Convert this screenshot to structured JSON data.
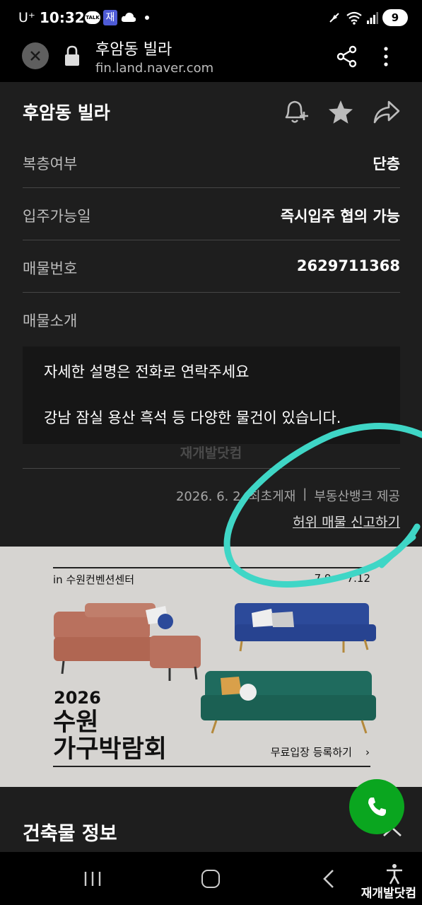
{
  "status_bar": {
    "carrier": "U⁺",
    "time": "10:32",
    "talk_badge": "TALK",
    "app_badge": "재",
    "battery": "9"
  },
  "browser": {
    "title": "후암동 빌라",
    "url": "fin.land.naver.com"
  },
  "listing": {
    "title": "후암동 빌라",
    "rows": [
      {
        "label": "복층여부",
        "value": "단층"
      },
      {
        "label": "입주가능일",
        "value": "즉시입주 협의 가능"
      },
      {
        "label": "매물번호",
        "value": "2629711368"
      }
    ],
    "description_label": "매물소개",
    "description_lines": [
      "자세한 설명은 전화로 연락주세요",
      "강남 잠실 용산 흑석 등 다양한 물건이 있습니다."
    ],
    "watermark": "재개발닷컴",
    "posted_date": "2026. 6. 2. 최초게재",
    "separator": "|",
    "provider": "부동산뱅크 제공",
    "report_link": "허위 매물 신고하기"
  },
  "ad": {
    "venue": "in 수원컨벤션센터",
    "dates": "7.9 ~ 7.12",
    "year": "2026",
    "title_line1": "수원",
    "title_line2": "가구박람회",
    "register": "무료입장 등록하기",
    "register_arrow": "›",
    "colors": {
      "background": "#d6d4d1",
      "sofa_brown": "#b9715e",
      "sofa_blue": "#2c4a9a",
      "sofa_green": "#1f6b5e"
    }
  },
  "section": {
    "title": "건축물 정보"
  },
  "nav": {
    "watermark": "재개발닷컴"
  },
  "colors": {
    "call_button": "#0aa61f",
    "annotation_stroke": "#3fd6c6"
  },
  "icons": [
    "close-icon",
    "lock-icon",
    "share-icon",
    "more-icon",
    "bell-add-icon",
    "star-icon",
    "forward-icon",
    "phone-icon",
    "chevron-up-icon",
    "accessibility-icon"
  ]
}
